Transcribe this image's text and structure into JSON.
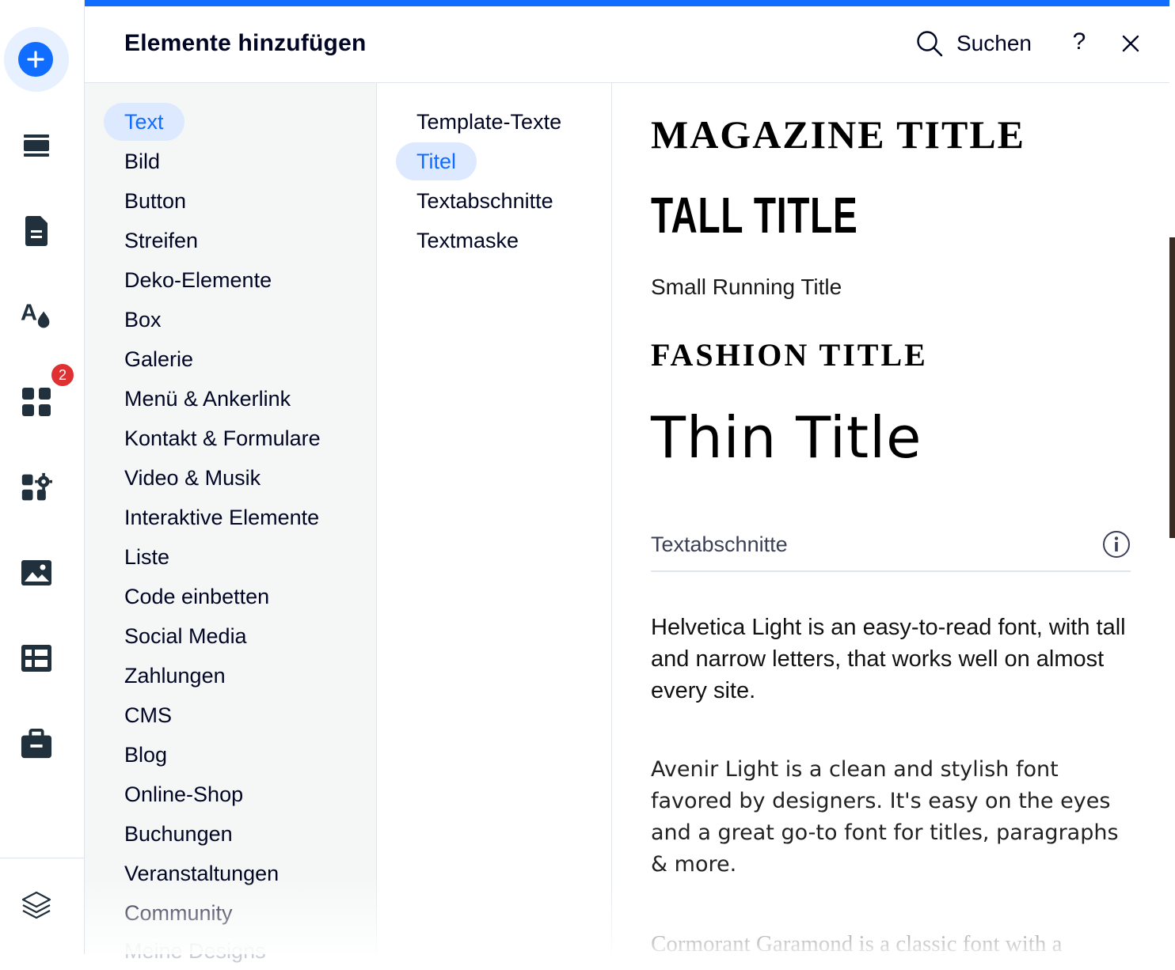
{
  "header": {
    "title": "Elemente hinzufügen",
    "search_label": "Suchen",
    "help_label": "?"
  },
  "rail": {
    "badge_count": "2",
    "items": [
      "add-elements",
      "sections",
      "pages",
      "design",
      "apps",
      "app-market",
      "media",
      "cms",
      "business",
      "layers"
    ]
  },
  "categories": [
    {
      "label": "Text",
      "active": true
    },
    {
      "label": "Bild"
    },
    {
      "label": "Button"
    },
    {
      "label": "Streifen"
    },
    {
      "label": "Deko-Elemente"
    },
    {
      "label": "Box"
    },
    {
      "label": "Galerie"
    },
    {
      "label": "Menü & Ankerlink"
    },
    {
      "label": "Kontakt & Formulare"
    },
    {
      "label": "Video & Musik"
    },
    {
      "label": "Interaktive Elemente"
    },
    {
      "label": "Liste"
    },
    {
      "label": "Code einbetten"
    },
    {
      "label": "Social Media"
    },
    {
      "label": "Zahlungen"
    },
    {
      "label": "CMS"
    },
    {
      "label": "Blog"
    },
    {
      "label": "Online-Shop"
    },
    {
      "label": "Buchungen"
    },
    {
      "label": "Veranstaltungen"
    },
    {
      "label": "Community"
    },
    {
      "label": "Meine Designs"
    }
  ],
  "subcategories": [
    {
      "label": "Template-Texte"
    },
    {
      "label": "Titel",
      "active": true
    },
    {
      "label": "Textabschnitte"
    },
    {
      "label": "Textmaske"
    }
  ],
  "preview": {
    "titles": {
      "magazine": "MAGAZINE TITLE",
      "tall": "TALL TITLE",
      "small_running": "Small Running Title",
      "fashion": "FASHION TITLE",
      "thin": "Thin Title"
    },
    "section_title": "Textabschnitte",
    "paragraphs": {
      "helvetica": "Helvetica Light is an easy-to-read font, with tall and narrow letters, that works well on almost every site.",
      "avenir": "Avenir Light is a clean and stylish font favored by designers. It's easy on the eyes and a great go-to font for titles, paragraphs & more.",
      "cormorant": "Cormorant Garamond is a classic font with a"
    }
  },
  "colors": {
    "accent": "#116dff",
    "accent_light": "#dce9ff",
    "badge": "#df3131",
    "text_dark": "#000624"
  }
}
